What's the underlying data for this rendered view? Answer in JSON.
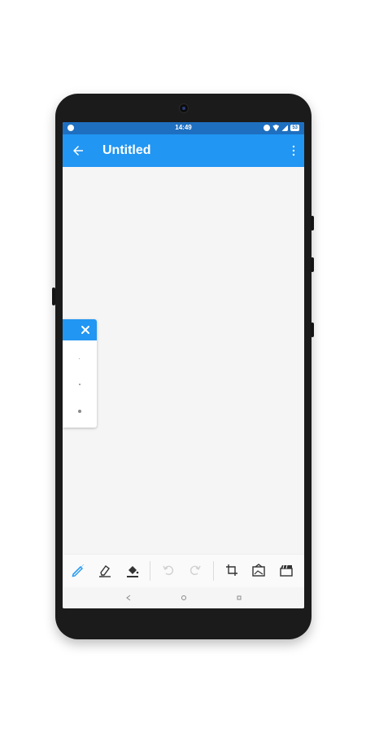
{
  "statusbar": {
    "time": "14:49",
    "battery": "53"
  },
  "appbar": {
    "title": "Untitled",
    "back_icon": "arrow-left-icon",
    "menu_icon": "more-vert-icon"
  },
  "brush_panel": {
    "close_icon": "close-icon",
    "sizes": [
      "small",
      "medium",
      "large"
    ]
  },
  "toolbar": {
    "tools": [
      "pencil-icon",
      "eraser-icon",
      "fill-bucket-icon",
      "undo-icon",
      "redo-icon",
      "crop-icon",
      "background-image-icon",
      "clapperboard-icon"
    ]
  },
  "colors": {
    "primary": "#2196f3",
    "statusbar": "#1e6fc0",
    "canvas": "#f5f5f5"
  }
}
